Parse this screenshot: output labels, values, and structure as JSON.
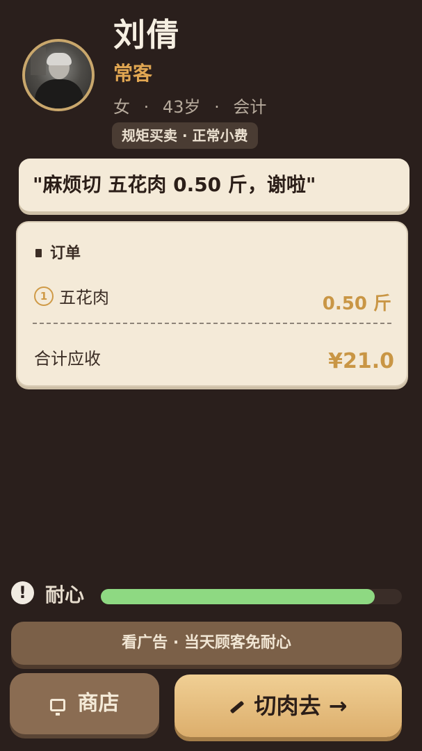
{
  "customer": {
    "name": "刘倩",
    "type": "常客",
    "gender": "女",
    "age": "43岁",
    "job": "会计",
    "separator": "·",
    "trait": "规矩买卖 · 正常小费"
  },
  "speech": "\"麻烦切 五花肉 0.50 斤，谢啦\"",
  "order": {
    "title": "订单",
    "items": [
      {
        "index": "1",
        "name": "五花肉",
        "qty": "0.50 斤"
      }
    ],
    "total_label": "合计应收",
    "total_value": "¥21.0"
  },
  "patience": {
    "icon": "!",
    "label": "耐心",
    "level_percent": 91,
    "color": "#8ed982"
  },
  "ad_button": "看广告 · 当天顾客免耐心",
  "shop_button": "商店",
  "cut_button": "切肉去 →",
  "colors": {
    "background": "#2a1f1c",
    "card": "#f4ead8",
    "accent": "#c99645",
    "tag": "#e0a652"
  }
}
